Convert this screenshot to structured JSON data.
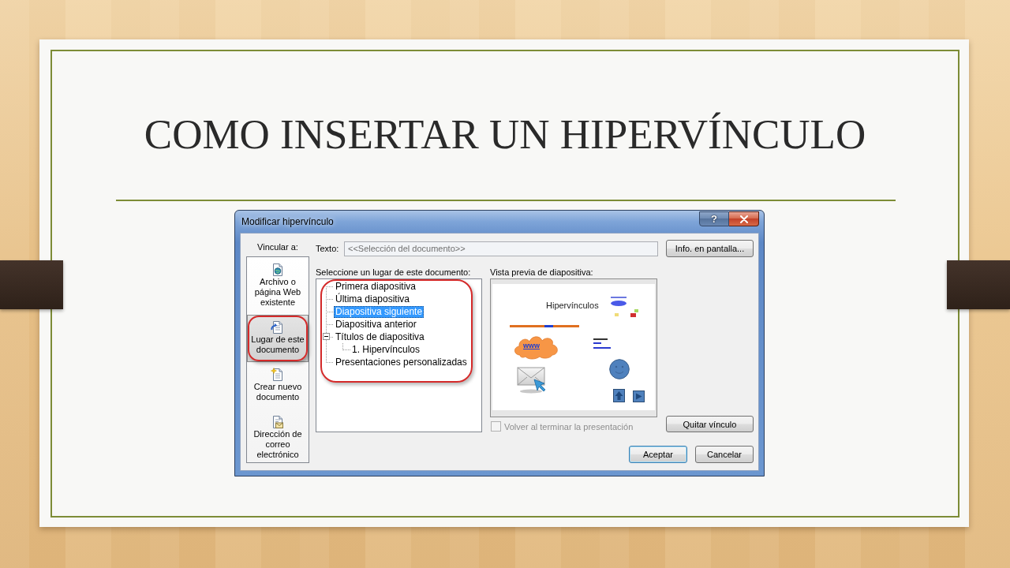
{
  "slide": {
    "title": "COMO INSERTAR UN HIPERVÍNCULO"
  },
  "dialog": {
    "title": "Modificar hipervínculo",
    "help_button": "?",
    "link_to": {
      "label": "Vincular a:",
      "items": [
        {
          "kind": "file",
          "label": "Archivo o página Web existente",
          "selected": false,
          "circled": false
        },
        {
          "kind": "place",
          "label": "Lugar de este documento",
          "selected": true,
          "circled": true
        },
        {
          "kind": "new",
          "label": "Crear nuevo documento",
          "selected": false,
          "circled": false
        },
        {
          "kind": "email",
          "label": "Dirección de correo electrónico",
          "selected": false,
          "circled": false
        }
      ]
    },
    "text_field": {
      "label": "Texto:",
      "value": "<<Selección del documento>>",
      "disabled": true
    },
    "screen_tip_button": "Info. en pantalla...",
    "place": {
      "label": "Seleccione un lugar de este documento:",
      "circled": true,
      "tree": [
        {
          "label": "Primera diapositiva",
          "selected": false
        },
        {
          "label": "Última diapositiva",
          "selected": false
        },
        {
          "label": "Diapositiva siguiente",
          "selected": true
        },
        {
          "label": "Diapositiva anterior",
          "selected": false
        },
        {
          "label": "Títulos de diapositiva",
          "selected": false,
          "expanded": true,
          "children": [
            {
              "label": "1. Hipervínculos",
              "selected": false
            }
          ]
        },
        {
          "label": "Presentaciones personalizadas",
          "selected": false
        }
      ]
    },
    "preview": {
      "label": "Vista previa de diapositiva:",
      "slide": {
        "title": "Hipervínculos",
        "cloud_text": "www"
      }
    },
    "return_checkbox": {
      "label": "Volver al terminar la presentación",
      "checked": false,
      "disabled": true
    },
    "remove_link_button": "Quitar vínculo",
    "buttons": [
      {
        "label": "Aceptar",
        "default": true
      },
      {
        "label": "Cancelar",
        "default": false
      }
    ]
  }
}
